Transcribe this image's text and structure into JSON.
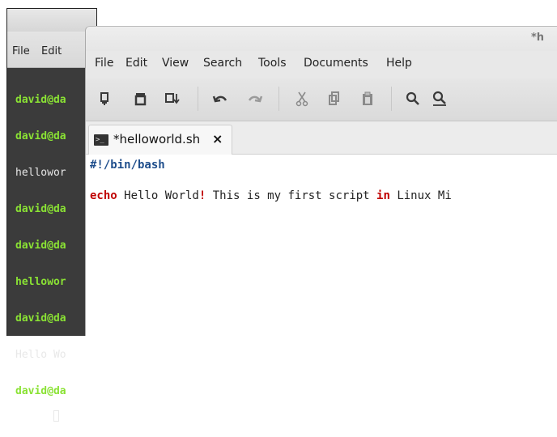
{
  "terminal": {
    "menu": [
      "File",
      "Edit"
    ],
    "lines": [
      {
        "text": "david@da",
        "style": "green"
      },
      {
        "text": "david@da",
        "style": "green"
      },
      {
        "text": "hellowor",
        "style": "white"
      },
      {
        "text": "david@da",
        "style": "green"
      },
      {
        "text": "david@da",
        "style": "green"
      },
      {
        "text": "hellowor",
        "style": "green"
      },
      {
        "text": "david@da",
        "style": "green"
      },
      {
        "text": "Hello Wo",
        "style": "white"
      },
      {
        "text": "david@da",
        "style": "green"
      }
    ]
  },
  "editor": {
    "title": "*h",
    "menu": [
      "File",
      "Edit",
      "View",
      "Search",
      "Tools",
      "Documents",
      "Help"
    ],
    "toolbar_icons": [
      "new-document-icon",
      "open-icon",
      "save-icon",
      "undo-icon",
      "redo-icon",
      "cut-icon",
      "copy-icon",
      "paste-icon",
      "search-icon",
      "search-replace-icon"
    ],
    "tab": {
      "label": "*helloworld.sh",
      "close": "×"
    },
    "code": {
      "line1": "#!/bin/bash",
      "kw_echo": "echo",
      "text_a": " Hello World",
      "kw_bang": "!",
      "text_b": " This is my first script ",
      "kw_in": "in",
      "text_c": " Linux Mi"
    }
  },
  "colors": {
    "prompt_green": "#8ae234",
    "keyword_red": "#c00000",
    "shebang_blue": "#1f4e8c",
    "terminal_bg": "#3b3b3b"
  }
}
